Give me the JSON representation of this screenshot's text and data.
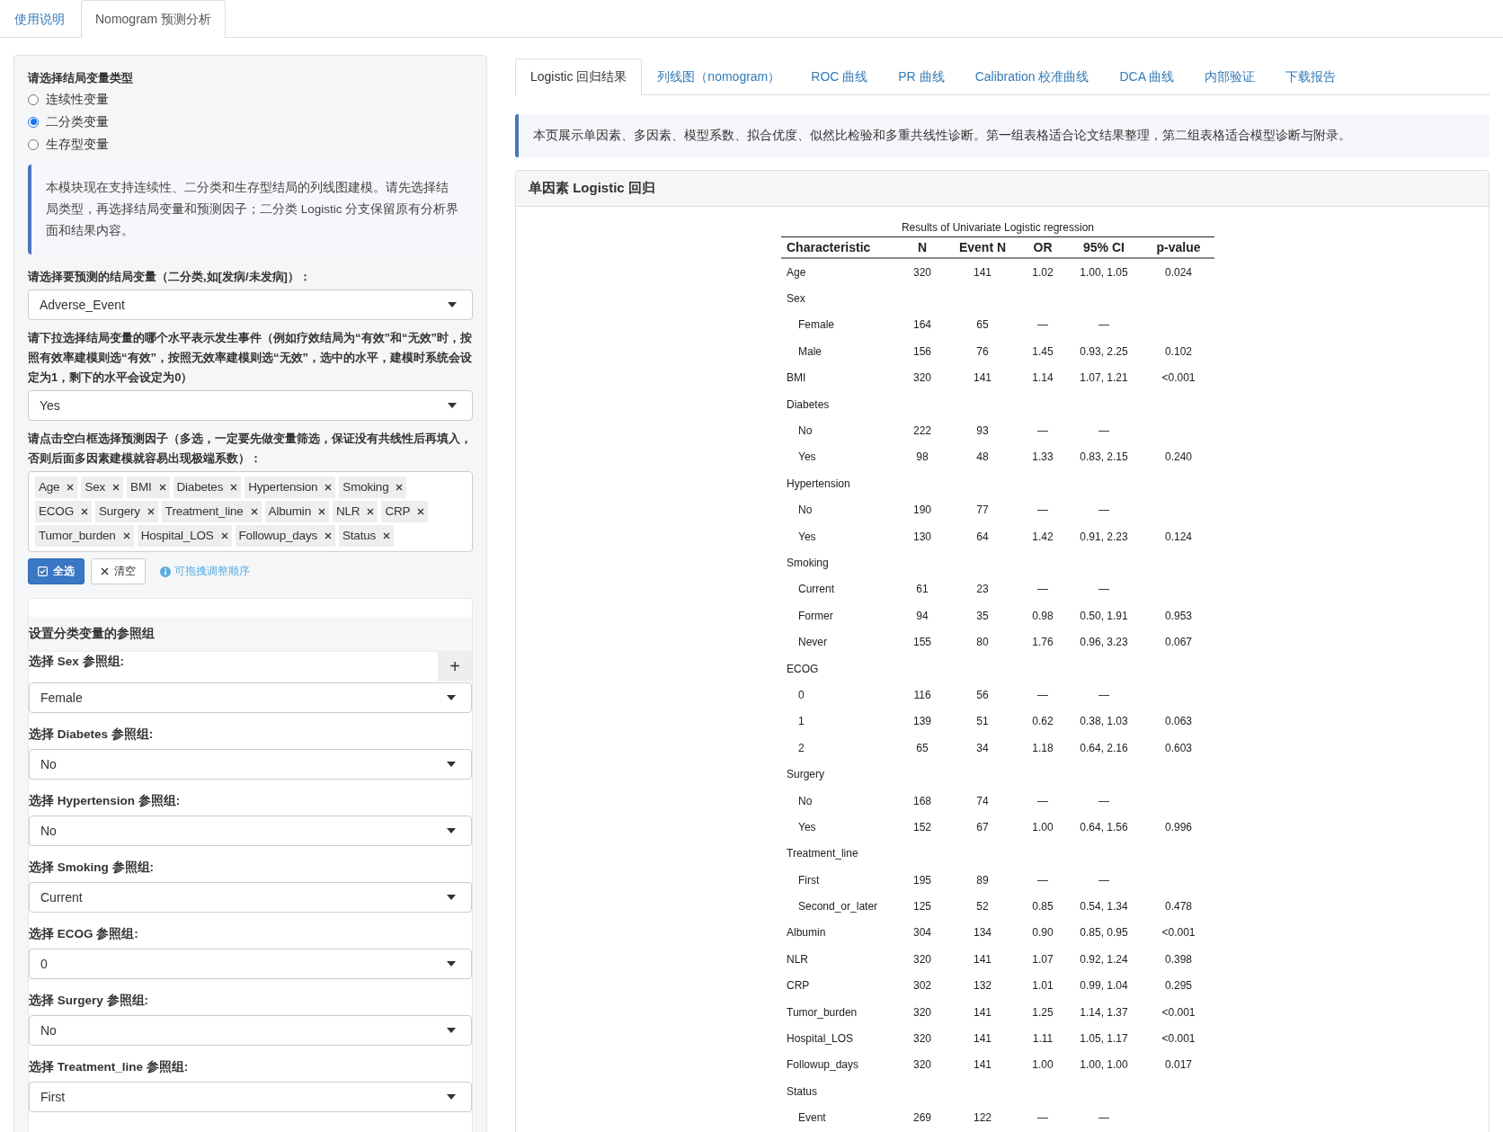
{
  "top_tabs": [
    {
      "label": "使用说明",
      "selected": false
    },
    {
      "label": "Nomogram 预测分析",
      "selected": true
    }
  ],
  "sidebar": {
    "outcome_type": {
      "label": "请选择结局变量类型",
      "options": [
        {
          "label": "连续性变量",
          "selected": false
        },
        {
          "label": "二分类变量",
          "selected": true
        },
        {
          "label": "生存型变量",
          "selected": false
        }
      ]
    },
    "info": "本模块现在支持连续性、二分类和生存型结局的列线图建模。请先选择结局类型，再选择结局变量和预测因子；二分类 Logistic 分支保留原有分析界面和结果内容。",
    "outcome_variable": {
      "label": "请选择要预测的结局变量（二分类,如[发病/未发病]）：",
      "value": "Adverse_Event"
    },
    "event_level": {
      "label": "请下拉选择结局变量的哪个水平表示发生事件（例如疗效结局为“有效”和“无效”时，按照有效率建模则选“有效”，按照无效率建模则选“无效”，选中的水平，建模时系统会设定为1，剩下的水平会设定为0）",
      "value": "Yes"
    },
    "predictors": {
      "label": "请点击空白框选择预测因子（多选，一定要先做变量筛选，保证没有共线性后再填入，否则后面多因素建模就容易出现极端系数）：",
      "tags": [
        "Age",
        "Sex",
        "BMI",
        "Diabetes",
        "Hypertension",
        "Smoking",
        "ECOG",
        "Surgery",
        "Treatment_line",
        "Albumin",
        "NLR",
        "CRP",
        "Tumor_burden",
        "Hospital_LOS",
        "Followup_days",
        "Status"
      ]
    },
    "buttons": [
      {
        "kind": "select_all",
        "label": "全选"
      },
      {
        "kind": "clear",
        "label": "清空"
      }
    ],
    "hint": "可拖拽调整顺序",
    "reference_groups": {
      "title": "设置分类变量的参照组",
      "toggle": "+",
      "items": [
        {
          "label": "选择 Sex 参照组:",
          "value": "Female"
        },
        {
          "label": "选择 Diabetes 参照组:",
          "value": "No"
        },
        {
          "label": "选择 Hypertension 参照组:",
          "value": "No"
        },
        {
          "label": "选择 Smoking 参照组:",
          "value": "Current"
        },
        {
          "label": "选择 ECOG 参照组:",
          "value": "0"
        },
        {
          "label": "选择 Surgery 参照组:",
          "value": "No"
        },
        {
          "label": "选择 Treatment_line 参照组:",
          "value": "First"
        }
      ]
    }
  },
  "result_tabs": [
    {
      "label": "Logistic 回归结果",
      "selected": true
    },
    {
      "label": "列线图（nomogram）",
      "selected": false
    },
    {
      "label": "ROC 曲线",
      "selected": false
    },
    {
      "label": "PR 曲线",
      "selected": false
    },
    {
      "label": "Calibration 校准曲线",
      "selected": false
    },
    {
      "label": "DCA 曲线",
      "selected": false
    },
    {
      "label": "内部验证",
      "selected": false
    },
    {
      "label": "下载报告",
      "selected": false
    }
  ],
  "note": "本页展示单因素、多因素、模型系数、拟合优度、似然比检验和多重共线性诊断。第一组表格适合论文结果整理，第二组表格适合模型诊断与附录。",
  "card": {
    "title": "单因素 Logistic 回归",
    "table": {
      "caption": "Results of Univariate Logistic regression",
      "columns": [
        "Characteristic",
        "N",
        "Event N",
        "OR",
        "95% CI",
        "p-value"
      ],
      "rows": [
        {
          "cells": [
            "Age",
            "320",
            "141",
            "1.02",
            "1.00, 1.05",
            "0.024"
          ]
        },
        {
          "cells": [
            "Sex"
          ],
          "children": [
            {
              "cells": [
                "Female",
                "164",
                "65",
                "—",
                "—"
              ]
            },
            {
              "cells": [
                "Male",
                "156",
                "76",
                "1.45",
                "0.93, 2.25",
                "0.102"
              ]
            }
          ]
        },
        {
          "cells": [
            "BMI",
            "320",
            "141",
            "1.14",
            "1.07, 1.21",
            "<0.001"
          ]
        },
        {
          "cells": [
            "Diabetes"
          ],
          "children": [
            {
              "cells": [
                "No",
                "222",
                "93",
                "—",
                "—"
              ]
            },
            {
              "cells": [
                "Yes",
                "98",
                "48",
                "1.33",
                "0.83, 2.15",
                "0.240"
              ]
            }
          ]
        },
        {
          "cells": [
            "Hypertension"
          ],
          "children": [
            {
              "cells": [
                "No",
                "190",
                "77",
                "—",
                "—"
              ]
            },
            {
              "cells": [
                "Yes",
                "130",
                "64",
                "1.42",
                "0.91, 2.23",
                "0.124"
              ]
            }
          ]
        },
        {
          "cells": [
            "Smoking"
          ],
          "children": [
            {
              "cells": [
                "Current",
                "61",
                "23",
                "—",
                "—"
              ]
            },
            {
              "cells": [
                "Former",
                "94",
                "35",
                "0.98",
                "0.50, 1.91",
                "0.953"
              ]
            },
            {
              "cells": [
                "Never",
                "155",
                "80",
                "1.76",
                "0.96, 3.23",
                "0.067"
              ]
            }
          ]
        },
        {
          "cells": [
            "ECOG"
          ],
          "children": [
            {
              "cells": [
                "0",
                "116",
                "56",
                "—",
                "—"
              ]
            },
            {
              "cells": [
                "1",
                "139",
                "51",
                "0.62",
                "0.38, 1.03",
                "0.063"
              ]
            },
            {
              "cells": [
                "2",
                "65",
                "34",
                "1.18",
                "0.64, 2.16",
                "0.603"
              ]
            }
          ]
        },
        {
          "cells": [
            "Surgery"
          ],
          "children": [
            {
              "cells": [
                "No",
                "168",
                "74",
                "—",
                "—"
              ]
            },
            {
              "cells": [
                "Yes",
                "152",
                "67",
                "1.00",
                "0.64, 1.56",
                "0.996"
              ]
            }
          ]
        },
        {
          "cells": [
            "Treatment_line"
          ],
          "children": [
            {
              "cells": [
                "First",
                "195",
                "89",
                "—",
                "—"
              ]
            },
            {
              "cells": [
                "Second_or_later",
                "125",
                "52",
                "0.85",
                "0.54, 1.34",
                "0.478"
              ]
            }
          ]
        },
        {
          "cells": [
            "Albumin",
            "304",
            "134",
            "0.90",
            "0.85, 0.95",
            "<0.001"
          ]
        },
        {
          "cells": [
            "NLR",
            "320",
            "141",
            "1.07",
            "0.92, 1.24",
            "0.398"
          ]
        },
        {
          "cells": [
            "CRP",
            "302",
            "132",
            "1.01",
            "0.99, 1.04",
            "0.295"
          ]
        },
        {
          "cells": [
            "Tumor_burden",
            "320",
            "141",
            "1.25",
            "1.14, 1.37",
            "<0.001"
          ]
        },
        {
          "cells": [
            "Hospital_LOS",
            "320",
            "141",
            "1.11",
            "1.05, 1.17",
            "<0.001"
          ]
        },
        {
          "cells": [
            "Followup_days",
            "320",
            "141",
            "1.00",
            "1.00, 1.00",
            "0.017"
          ]
        },
        {
          "cells": [
            "Status"
          ],
          "children": [
            {
              "cells": [
                "Event",
                "269",
                "122",
                "—",
                "—"
              ]
            }
          ]
        }
      ]
    }
  }
}
